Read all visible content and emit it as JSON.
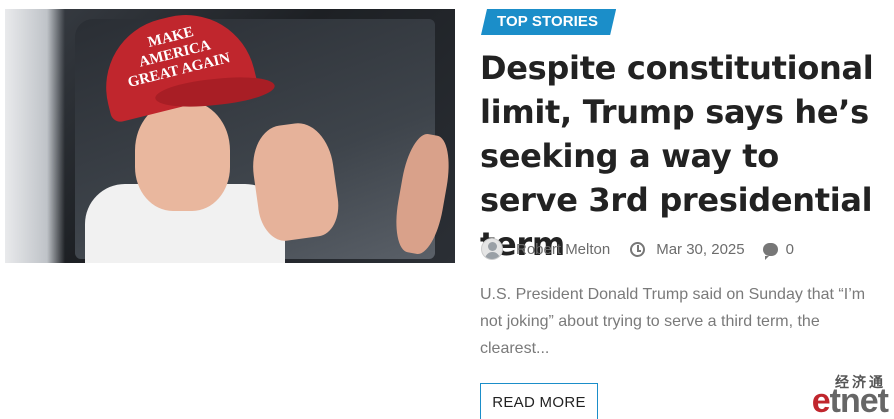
{
  "article": {
    "category": "TOP STORIES",
    "title": "Despite constitutional limit, Trump says he’s seeking a way to serve 3rd presidential term",
    "author": "Robert Melton",
    "date": "Mar 30, 2025",
    "comments": "0",
    "excerpt": "U.S. President Donald Trump said on Sunday that “I’m not joking” about trying to serve a third term, the clearest...",
    "read_more_label": "READ MORE",
    "image": {
      "cap_text": "MAKE AMERICA GREAT AGAIN"
    }
  },
  "watermark": {
    "cn": "经济通",
    "en_prefix": "e",
    "en_rest": "tnet"
  },
  "colors": {
    "accent": "#1b8ec9",
    "cap_red": "#c0262d"
  },
  "icons": {
    "clock": "clock-icon",
    "comment": "comment-icon",
    "avatar": "avatar"
  }
}
